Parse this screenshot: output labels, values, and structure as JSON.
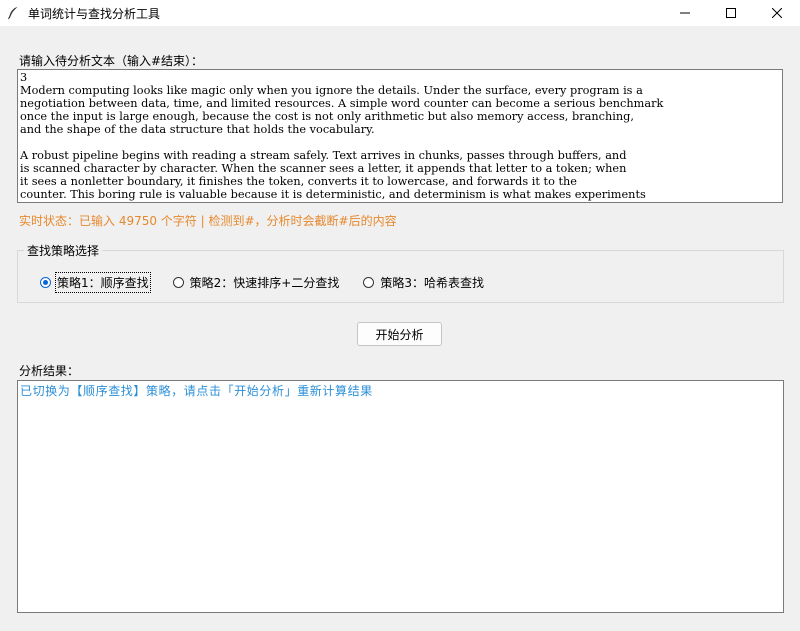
{
  "window": {
    "title": "单词统计与查找分析工具"
  },
  "input_section": {
    "label": "请输入待分析文本（输入#结束）：",
    "content_lines": [
      "3",
      "Modern computing looks like magic only when you ignore the details. Under the surface, every program is a",
      "negotiation between data, time, and limited resources. A simple word counter can become a serious benchmark",
      "once the input is large enough, because the cost is not only arithmetic but also memory access, branching,",
      "and the shape of the data structure that holds the vocabulary.",
      "",
      "A robust pipeline begins with reading a stream safely. Text arrives in chunks, passes through buffers, and",
      "is scanned character by character. When the scanner sees a letter, it appends that letter to a token; when",
      "it sees a nonletter boundary, it finishes the token, converts it to lowercase, and forwards it to the",
      "counter. This boring rule is valuable because it is deterministic, and determinism is what makes experiments"
    ]
  },
  "status": {
    "text": "实时状态：已输入 49750 个字符 | 检测到#，分析时会截断#后的内容",
    "color": "#e6892d"
  },
  "strategy": {
    "legend": "查找策略选择",
    "options": [
      {
        "label": "策略1：顺序查找",
        "checked": true
      },
      {
        "label": "策略2：快速排序+二分查找",
        "checked": false
      },
      {
        "label": "策略3：哈希表查找",
        "checked": false
      }
    ],
    "accent_color": "#0a64d6"
  },
  "actions": {
    "start_label": "开始分析"
  },
  "result_section": {
    "label": "分析结果：",
    "text": "已切换为【顺序查找】策略，请点击「开始分析」重新计算结果",
    "color": "#2b8fd8"
  }
}
